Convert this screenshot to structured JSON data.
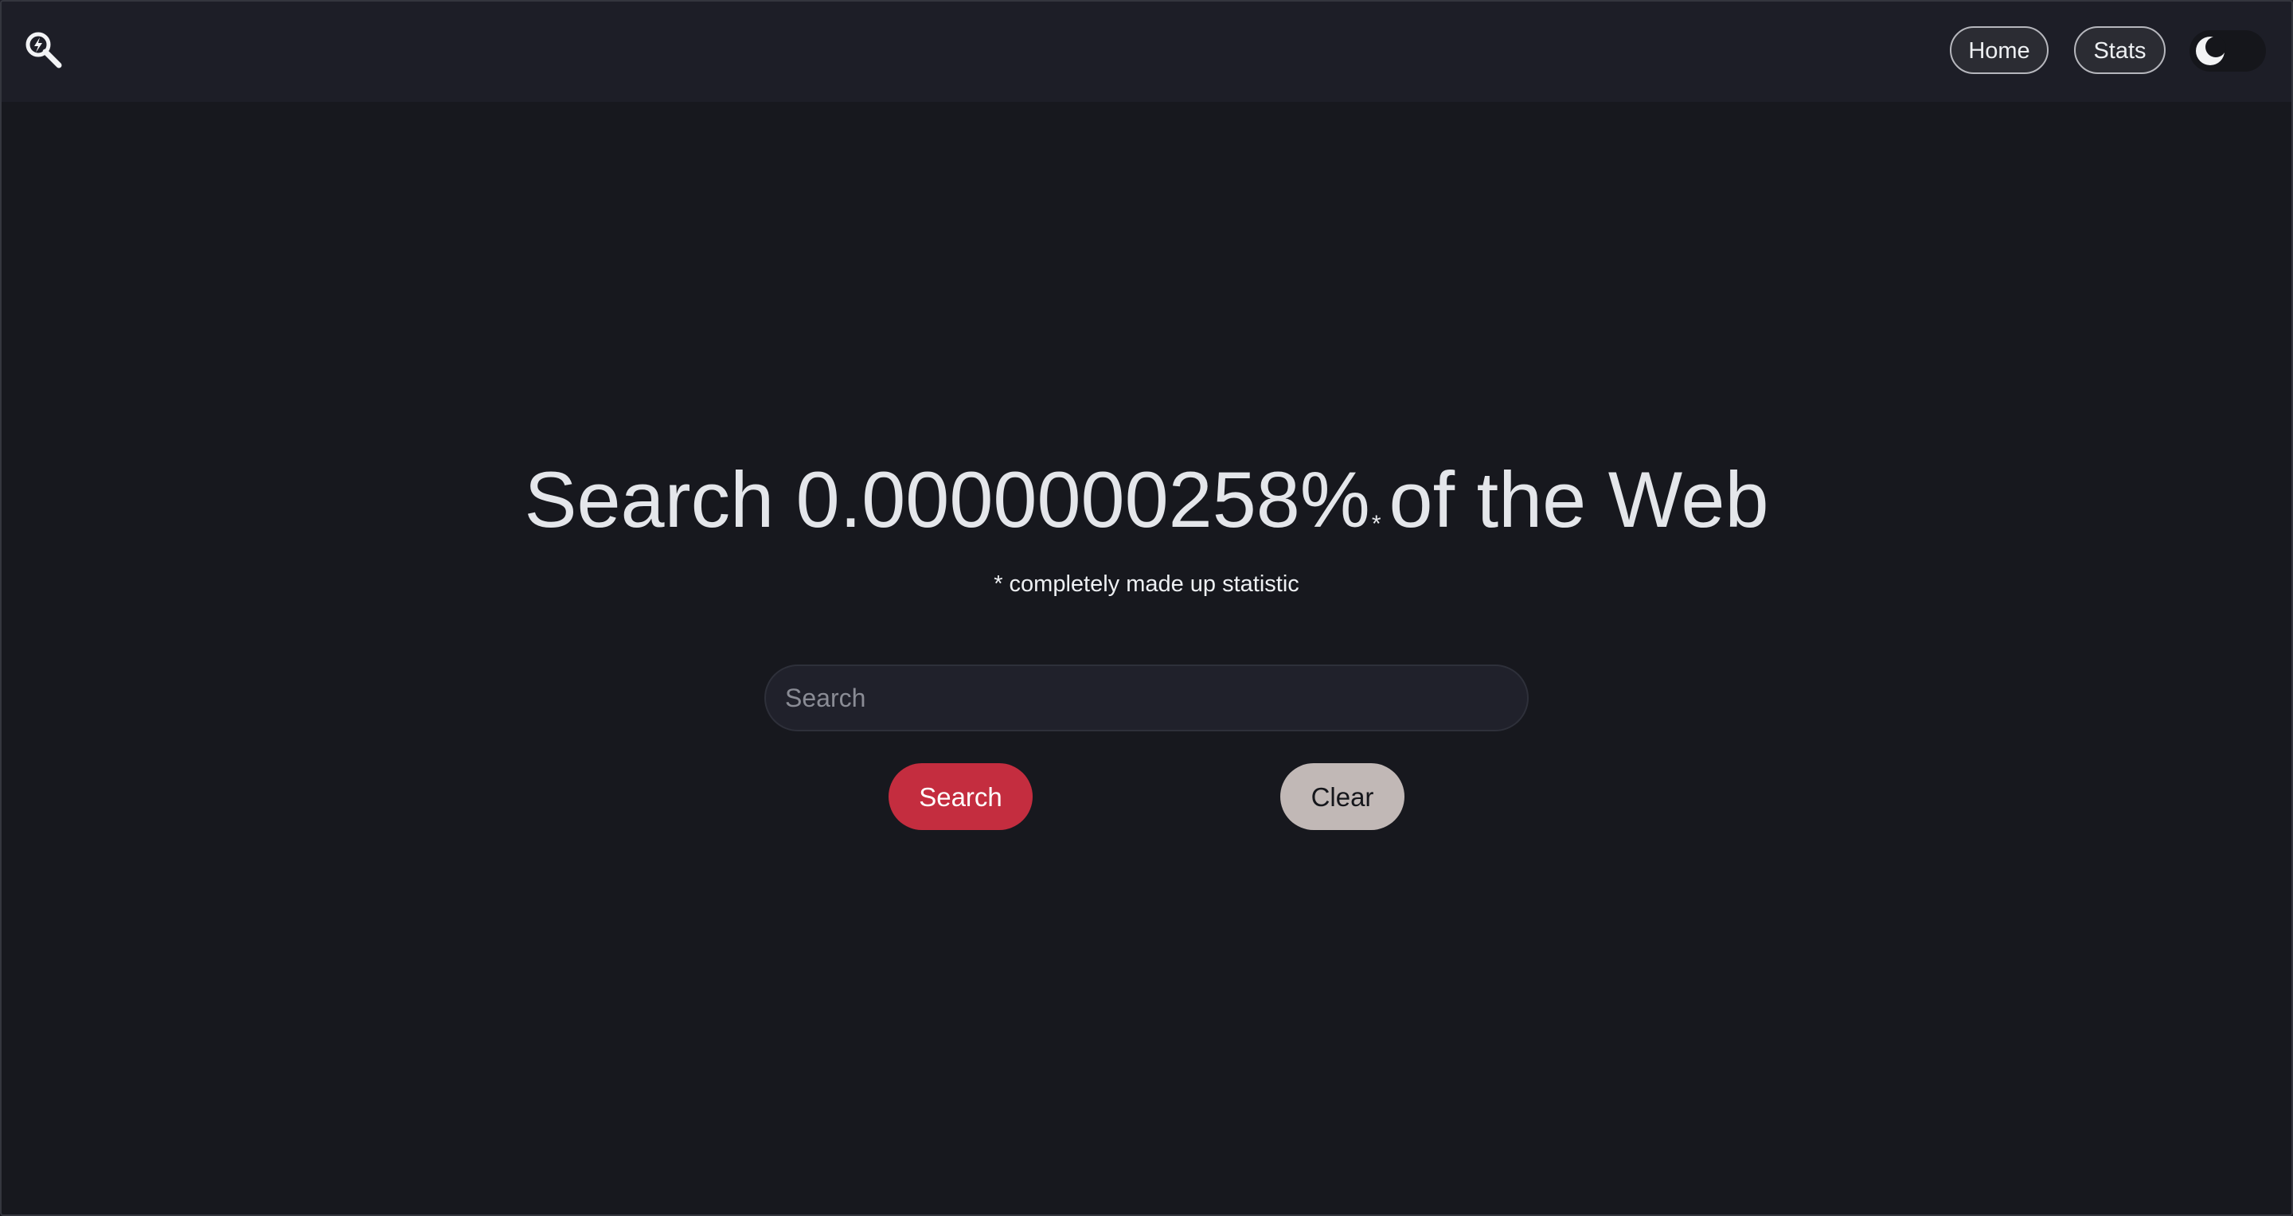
{
  "nav": {
    "logo_icon": "search-lightning-icon",
    "home_label": "Home",
    "stats_label": "Stats",
    "theme_toggle_icon": "moon-icon",
    "theme": "dark"
  },
  "hero": {
    "headline_prefix": "Search 0.0000000258%",
    "headline_star": "*",
    "headline_suffix": "of the Web",
    "footnote": "* completely made up statistic"
  },
  "search": {
    "placeholder": "Search",
    "value": "",
    "search_button_label": "Search",
    "clear_button_label": "Clear"
  },
  "colors": {
    "background": "#17181e",
    "navbar": "#1d1e27",
    "search_button": "#c42d3f",
    "clear_button": "#c1b8b6"
  }
}
